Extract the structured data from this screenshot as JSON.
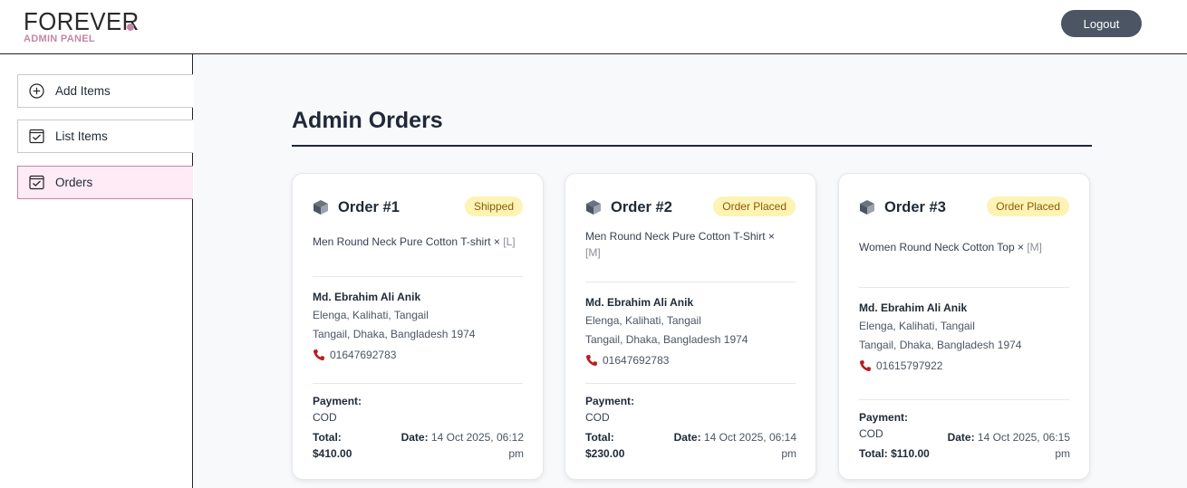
{
  "header": {
    "logo_text": "FOREVER",
    "logo_sub": "ADMIN PANEL",
    "logout_label": "Logout"
  },
  "sidebar": {
    "items": [
      {
        "label": "Add Items",
        "icon": "plus-circle-icon"
      },
      {
        "label": "List Items",
        "icon": "checkbox-icon"
      },
      {
        "label": "Orders",
        "icon": "checkbox-icon",
        "active": true
      }
    ]
  },
  "page": {
    "title": "Admin Orders"
  },
  "orders": [
    {
      "title": "Order #1",
      "status": "Shipped",
      "item_name": "Men Round Neck Pure Cotton T-shirt ×",
      "item_size": "[L]",
      "customer_name": "Md. Ebrahim Ali Anik",
      "address_line1": "Elenga, Kalihati, Tangail",
      "address_line2": "Tangail, Dhaka, Bangladesh 1974",
      "phone": "01647692783",
      "payment_label": "Payment:",
      "payment_method": "COD",
      "total_label": "Total:",
      "total_value": "$410.00",
      "date_label": "Date:",
      "date_value": "14 Oct 2025, 06:12",
      "date_suffix": "pm"
    },
    {
      "title": "Order #2",
      "status": "Order Placed",
      "item_name": "Men Round Neck Pure Cotton T-Shirt ×",
      "item_size": "[M]",
      "customer_name": "Md. Ebrahim Ali Anik",
      "address_line1": "Elenga, Kalihati, Tangail",
      "address_line2": "Tangail, Dhaka, Bangladesh 1974",
      "phone": "01647692783",
      "payment_label": "Payment:",
      "payment_method": "COD",
      "total_label": "Total:",
      "total_value": "$230.00",
      "date_label": "Date:",
      "date_value": "14 Oct 2025, 06:14",
      "date_suffix": "pm"
    },
    {
      "title": "Order #3",
      "status": "Order Placed",
      "item_name": "Women Round Neck Cotton Top ×",
      "item_size": "[M]",
      "customer_name": "Md. Ebrahim Ali Anik",
      "address_line1": "Elenga, Kalihati, Tangail",
      "address_line2": "Tangail, Dhaka, Bangladesh 1974",
      "phone": "01615797922",
      "payment_label": "Payment:",
      "payment_method": "COD",
      "total_label": "Total:",
      "total_value": "$110.00",
      "date_label": "Date:",
      "date_value": "14 Oct 2025, 06:15",
      "date_suffix": "pm"
    }
  ],
  "colors": {
    "brand_pink": "#c586a5",
    "active_bg": "#ffebf5",
    "badge_bg": "#fdf3b5",
    "badge_text": "#8a5a06",
    "logout_bg": "#4b5563"
  }
}
